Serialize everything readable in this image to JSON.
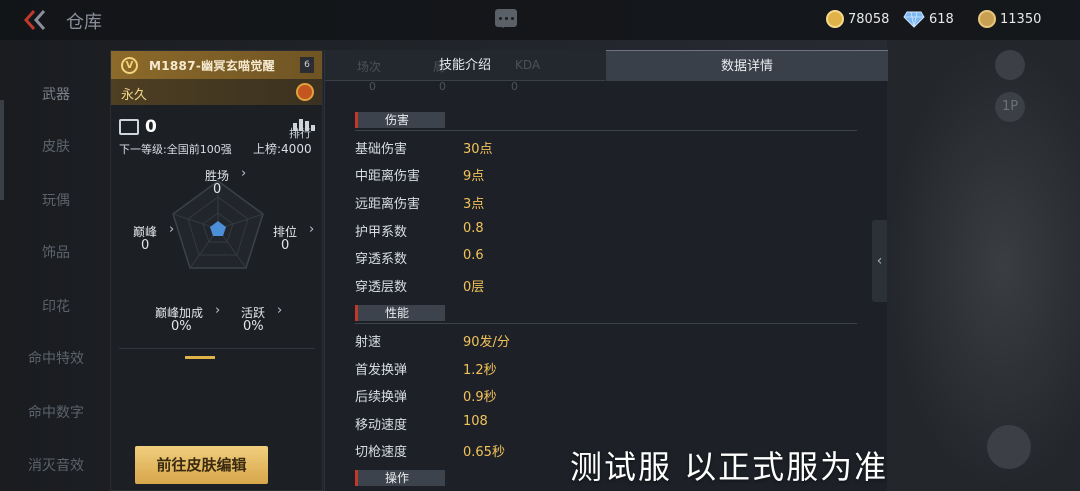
{
  "header": {
    "back_icon": "double-chevron-left-icon",
    "title": "仓库",
    "chat_icon": "chat-bubble-icon",
    "currencies": [
      {
        "icon": "gold-coin-icon",
        "value": "78058",
        "color": "#e0b24a"
      },
      {
        "icon": "diamond-icon",
        "value": "618",
        "color": "#7fb8f0"
      },
      {
        "icon": "token-icon",
        "value": "11350",
        "color": "#c9a052"
      }
    ]
  },
  "nav": {
    "items": [
      "武器",
      "皮肤",
      "玩偶",
      "饰品",
      "印花",
      "命中特效",
      "命中数字",
      "消灭音效"
    ]
  },
  "card": {
    "name": "M1887-幽冥玄喵觉醒",
    "level": "6",
    "duration": "永久",
    "kills": "0",
    "rank_list_label": "排行",
    "next_level": "下一等级:全国前100强",
    "top_label": "上榜:4000",
    "radar": {
      "win": {
        "label": "胜场",
        "value": "0"
      },
      "rank": {
        "label": "排位",
        "value": "0"
      },
      "peak": {
        "label": "巅峰",
        "value": "0"
      },
      "peak_bonus": {
        "label": "巅峰加成",
        "value": "0%"
      },
      "active": {
        "label": "活跃",
        "value": "0%"
      }
    },
    "edit_button": "前往皮肤编辑"
  },
  "panel": {
    "ghost_labels": [
      "场次",
      "局",
      "KDA"
    ],
    "ghost_values": [
      "0",
      "0",
      "0"
    ],
    "tabs": [
      {
        "label": "技能介绍",
        "active": false
      },
      {
        "label": "数据详情",
        "active": true
      }
    ],
    "sections": {
      "damage": {
        "title": "伤害",
        "rows": [
          {
            "k": "基础伤害",
            "v": "30点"
          },
          {
            "k": "中距离伤害",
            "v": "9点"
          },
          {
            "k": "远距离伤害",
            "v": "3点"
          },
          {
            "k": "护甲系数",
            "v": "0.8"
          },
          {
            "k": "穿透系数",
            "v": "0.6"
          },
          {
            "k": "穿透层数",
            "v": "0层"
          }
        ]
      },
      "performance": {
        "title": "性能",
        "rows": [
          {
            "k": "射速",
            "v": "90发/分"
          },
          {
            "k": "首发换弹",
            "v": "1.2秒"
          },
          {
            "k": "后续换弹",
            "v": "0.9秒"
          },
          {
            "k": "移动速度",
            "v": "108"
          },
          {
            "k": "切枪速度",
            "v": "0.65秒"
          }
        ]
      },
      "operation": {
        "title": "操作"
      }
    },
    "collapse_icon": "chevron-left-icon"
  },
  "background_buttons": [
    "1P"
  ],
  "watermark": "测试服 以正式服为准"
}
